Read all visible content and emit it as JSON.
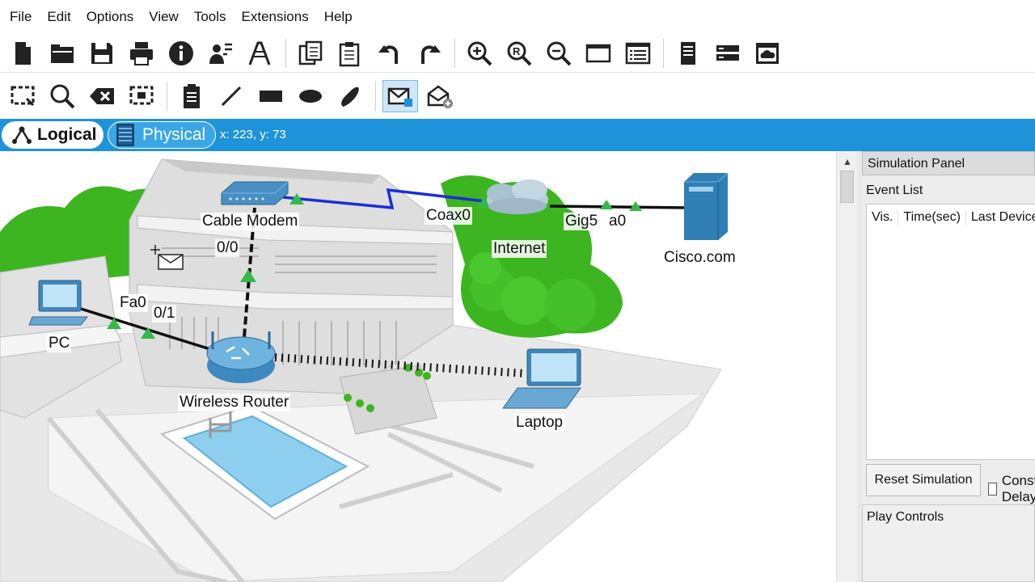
{
  "menu": [
    "File",
    "Edit",
    "Options",
    "View",
    "Tools",
    "Extensions",
    "Help"
  ],
  "toolbar_main_icons": [
    "new-file-icon",
    "open-folder-icon",
    "save-icon",
    "print-icon",
    "info-icon",
    "activity-wizard-icon",
    "custom-device-icon",
    "copy-icon",
    "paste-icon",
    "undo-icon",
    "redo-icon",
    "zoom-in-icon",
    "zoom-reset-icon",
    "zoom-out-icon",
    "drawing-palette-icon",
    "custom-devices-dialog-icon",
    "viewport-icon",
    "network-info-icon",
    "cloud-window-icon"
  ],
  "toolbar_draw_icons": [
    "select-icon",
    "inspect-icon",
    "delete-icon",
    "resize-shape-icon",
    "place-note-icon",
    "draw-line-icon",
    "draw-rectangle-icon",
    "draw-ellipse-icon",
    "freeform-icon",
    "simple-pdu-icon",
    "complex-pdu-icon"
  ],
  "modes": {
    "logical": "Logical",
    "physical": "Physical",
    "coords": "x: 223, y: 73"
  },
  "devices": {
    "cable_modem": "Cable Modem",
    "internet": "Internet",
    "cisco": "Cisco.com",
    "pc": "PC",
    "router": "Wireless Router",
    "laptop": "Laptop"
  },
  "ports": {
    "coax0": "Coax0",
    "gig5": "Gig5",
    "a0": "a0",
    "p00": "0/0",
    "fa0": "Fa0",
    "p01": "0/1"
  },
  "sim_panel": {
    "title": "Simulation Panel",
    "event_list": "Event List",
    "columns": [
      "Vis.",
      "Time(sec)",
      "Last Device"
    ],
    "reset": "Reset Simulation",
    "constant_delay": "Constant Delay",
    "play_controls": "Play Controls"
  },
  "colors": {
    "accent": "#1f93d9",
    "link_blue": "#1a2fd6",
    "tree_green": "#3cb520"
  }
}
